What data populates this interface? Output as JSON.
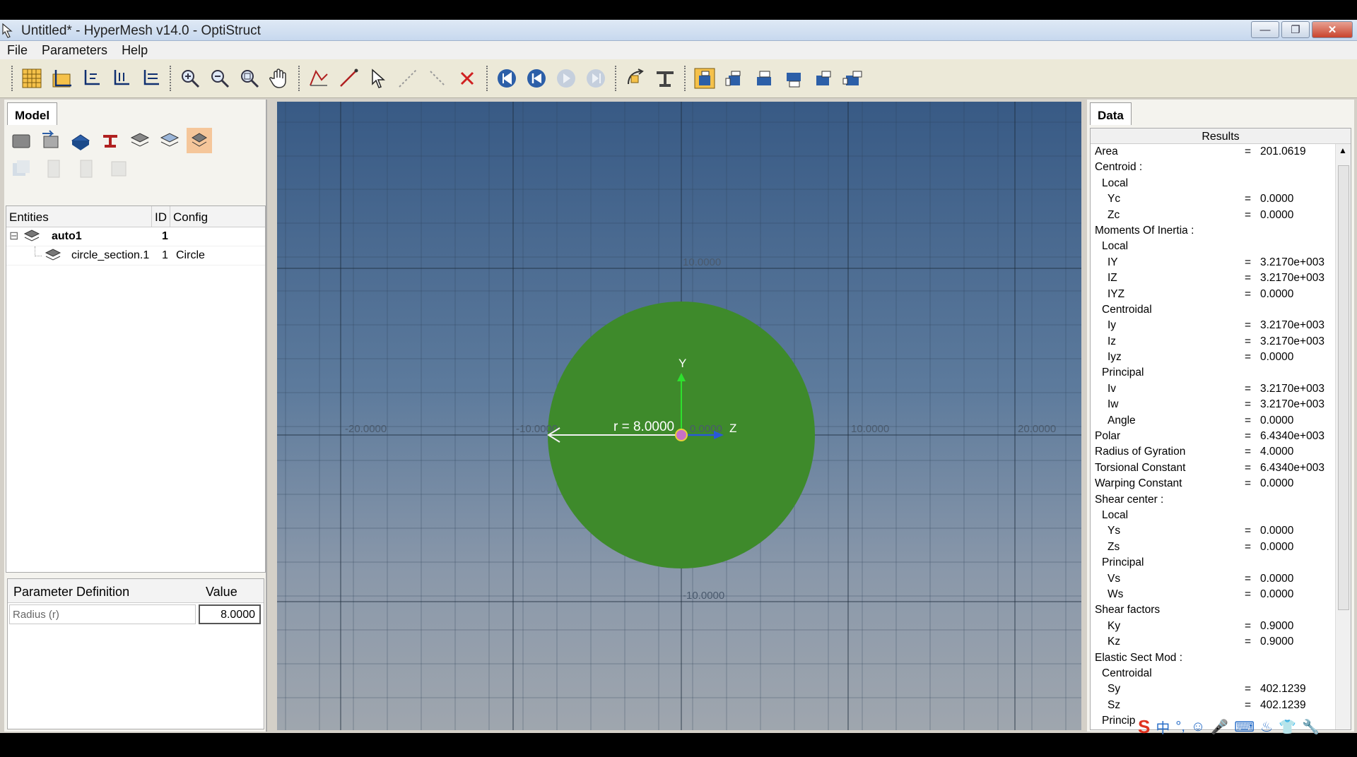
{
  "window": {
    "title": "Untitled* - HyperMesh v14.0 - OptiStruct",
    "minimize": "—",
    "maximize": "❐",
    "close": "✕"
  },
  "menu": [
    "File",
    "Parameters",
    "Help"
  ],
  "left_panel": {
    "tab": "Model",
    "columns": {
      "entities": "Entities",
      "id": "ID",
      "config": "Config"
    },
    "tree": {
      "root": {
        "expander": "⊟",
        "name": "auto1",
        "id": "1"
      },
      "child": {
        "name": "circle_section.1",
        "id": "1",
        "config": "Circle"
      }
    },
    "params": {
      "col_def": "Parameter Definition",
      "col_value": "Value",
      "row_name": "Radius (r)",
      "row_value": "8.0000"
    }
  },
  "viewport": {
    "radius_label": "r = 8.0000",
    "y_axis": "Y",
    "z_axis": "Z",
    "ticks": {
      "x_neg20": "-20.0000",
      "x_neg10": "-10.0000",
      "x_0": "0.0000",
      "x_10": "10.0000",
      "x_20": "20.0000",
      "y_10": "10.0000",
      "y_neg10": "-10.0000"
    },
    "circle_color": "#3e8a2b"
  },
  "right_panel": {
    "tab": "Data",
    "header": "Results",
    "rows": [
      {
        "indent": 0,
        "label": "Area",
        "eq": "=",
        "value": "201.0619"
      },
      {
        "indent": 0,
        "label": "Centroid :",
        "eq": "",
        "value": ""
      },
      {
        "indent": 1,
        "label": "Local",
        "eq": "",
        "value": ""
      },
      {
        "indent": 2,
        "label": "Yc",
        "eq": "=",
        "value": "0.0000"
      },
      {
        "indent": 2,
        "label": "Zc",
        "eq": "=",
        "value": "0.0000"
      },
      {
        "indent": 0,
        "label": "Moments Of Inertia :",
        "eq": "",
        "value": ""
      },
      {
        "indent": 1,
        "label": "Local",
        "eq": "",
        "value": ""
      },
      {
        "indent": 2,
        "label": "IY",
        "eq": "=",
        "value": "3.2170e+003"
      },
      {
        "indent": 2,
        "label": "IZ",
        "eq": "=",
        "value": "3.2170e+003"
      },
      {
        "indent": 2,
        "label": "IYZ",
        "eq": "=",
        "value": "0.0000"
      },
      {
        "indent": 1,
        "label": "Centroidal",
        "eq": "",
        "value": ""
      },
      {
        "indent": 2,
        "label": "Iy",
        "eq": "=",
        "value": "3.2170e+003"
      },
      {
        "indent": 2,
        "label": "Iz",
        "eq": "=",
        "value": "3.2170e+003"
      },
      {
        "indent": 2,
        "label": "Iyz",
        "eq": "=",
        "value": "0.0000"
      },
      {
        "indent": 1,
        "label": "Principal",
        "eq": "",
        "value": ""
      },
      {
        "indent": 2,
        "label": "Iv",
        "eq": "=",
        "value": "3.2170e+003"
      },
      {
        "indent": 2,
        "label": "Iw",
        "eq": "=",
        "value": "3.2170e+003"
      },
      {
        "indent": 2,
        "label": "Angle",
        "eq": "=",
        "value": "0.0000"
      },
      {
        "indent": 0,
        "label": "Polar",
        "eq": "=",
        "value": "6.4340e+003"
      },
      {
        "indent": 0,
        "label": "Radius of Gyration",
        "eq": "=",
        "value": "4.0000"
      },
      {
        "indent": 0,
        "label": "Torsional Constant",
        "eq": "=",
        "value": "6.4340e+003"
      },
      {
        "indent": 0,
        "label": "Warping Constant",
        "eq": "=",
        "value": "0.0000"
      },
      {
        "indent": 0,
        "label": "Shear center :",
        "eq": "",
        "value": ""
      },
      {
        "indent": 1,
        "label": "Local",
        "eq": "",
        "value": ""
      },
      {
        "indent": 2,
        "label": "Ys",
        "eq": "=",
        "value": "0.0000"
      },
      {
        "indent": 2,
        "label": "Zs",
        "eq": "=",
        "value": "0.0000"
      },
      {
        "indent": 1,
        "label": "Principal",
        "eq": "",
        "value": ""
      },
      {
        "indent": 2,
        "label": "Vs",
        "eq": "=",
        "value": "0.0000"
      },
      {
        "indent": 2,
        "label": "Ws",
        "eq": "=",
        "value": "0.0000"
      },
      {
        "indent": 0,
        "label": "Shear factors",
        "eq": "",
        "value": ""
      },
      {
        "indent": 2,
        "label": "Ky",
        "eq": "=",
        "value": "0.9000"
      },
      {
        "indent": 2,
        "label": "Kz",
        "eq": "=",
        "value": "0.9000"
      },
      {
        "indent": 0,
        "label": "Elastic Sect Mod :",
        "eq": "",
        "value": ""
      },
      {
        "indent": 1,
        "label": "Centroidal",
        "eq": "",
        "value": ""
      },
      {
        "indent": 2,
        "label": "Sy",
        "eq": "=",
        "value": "402.1239"
      },
      {
        "indent": 2,
        "label": "Sz",
        "eq": "=",
        "value": "402.1239"
      },
      {
        "indent": 1,
        "label": "Princip",
        "eq": "",
        "value": ""
      }
    ]
  },
  "tray": [
    "S",
    "中",
    "°,",
    "☺",
    "🎤",
    "⌨",
    "♨",
    "👕",
    "🔧"
  ]
}
